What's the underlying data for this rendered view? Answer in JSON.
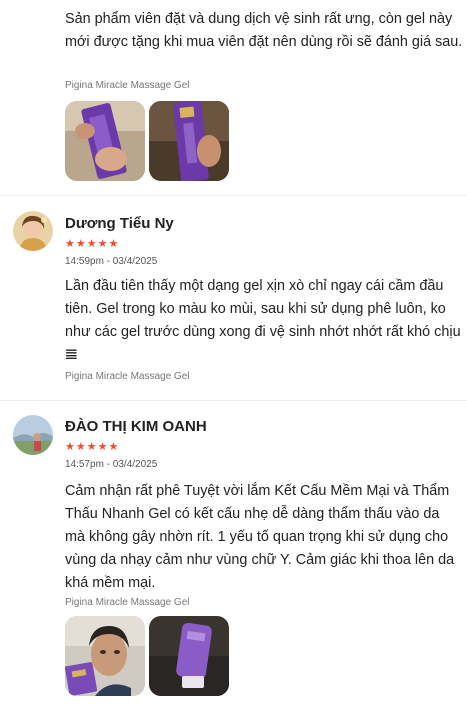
{
  "reviews": [
    {
      "text": "Sản phẩm viên đặt và dung dịch vệ sinh rất ưng, còn gel này mới được tặng khi mua viên đặt nên dùng rồi sẽ đánh giá sau.",
      "product": "Pigina Miracle Massage Gel",
      "photos": [
        "photo-purple-box-hand",
        "photo-purple-box-gold"
      ]
    },
    {
      "name": "Dương Tiểu Ny",
      "stars": "★★★★★",
      "rating": 5,
      "date": "14:59pm - 03/4/2025",
      "text": "Lần đầu tiên thấy một dạng gel xịn xò chỉ ngay cái cầm đầu tiên. Gel trong ko màu ko mùi, sau khi sử dụng phê luôn, ko như các gel trước dùng xong đi vệ sinh nhớt nhớt rất khó chịu 𝌆",
      "product": "Pigina Miracle Massage Gel"
    },
    {
      "name": "ĐÀO THỊ KIM OANH",
      "stars": "★★★★★",
      "rating": 5,
      "date": "14:57pm - 03/4/2025",
      "text": "Cảm nhận rất phê Tuyệt vời lắm Kết Cấu Mềm Mại và Thẩm Thấu Nhanh Gel có kết cấu nhẹ dễ dàng thẩm thấu vào da mà không gây nhờn rít. 1 yếu tố quan trọng khi sử dụng cho vùng da nhạy cảm như vùng chữ Y. Cảm giác khi thoa lên da khá mềm mại.",
      "product": "Pigina Miracle Massage Gel",
      "photos": [
        "photo-selfie-with-product",
        "photo-purple-tube"
      ]
    }
  ],
  "colors": {
    "star": "#ee4d2d",
    "product_text": "#777777"
  }
}
